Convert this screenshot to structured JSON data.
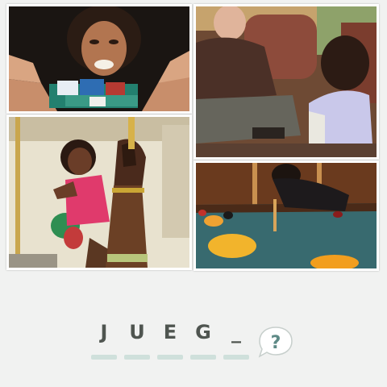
{
  "puzzle": {
    "images": [
      {
        "name": "poker-chips-photo"
      },
      {
        "name": "grandfather-child-photo"
      },
      {
        "name": "carousel-girl-photo"
      },
      {
        "name": "billiards-photo"
      }
    ],
    "letters": [
      "J",
      "U",
      "E",
      "G",
      "_"
    ],
    "slot_count": 5,
    "hint_label": "?"
  },
  "colors": {
    "background": "#f1f2f1",
    "letter": "#4f5550",
    "slot": "#cfe0db"
  }
}
